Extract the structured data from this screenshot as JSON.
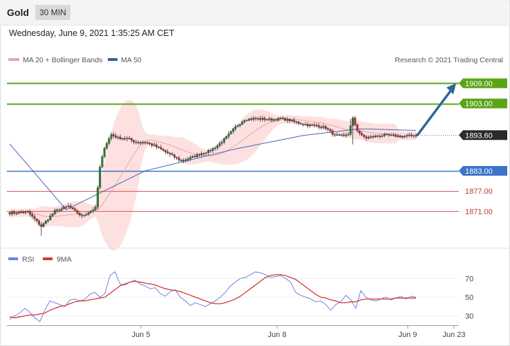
{
  "header": {
    "symbol": "Gold",
    "timeframe": "30 MIN"
  },
  "datetime": "Wednesday, June 9, 2021 1:35:25 AM CET",
  "copyright": "Research © 2021 Trading Central",
  "legend": {
    "bb": "MA 20 + Bollinger Bands",
    "ma50": "MA 50",
    "rsi": "RSI",
    "ma9": "9MA"
  },
  "colors": {
    "resistance": "#5aa517",
    "support": "#3b73c9",
    "target": "#e0585d",
    "current": "#2a2a2a",
    "candle_up": "#2e7d32",
    "candle_down": "#c62828",
    "bb_fill": "#fde0e0",
    "ma20": "#e8a6a6",
    "ma50": "#4a63b8",
    "rsi": "#6b85e0",
    "rsi_ma": "#d43838",
    "arrow": "#2f6699"
  },
  "chart_data": [
    {
      "type": "candlestick",
      "title": "Gold",
      "ylim": [
        1861,
        1914
      ],
      "x_ticks": [
        "Jun 5",
        "Jun 8",
        "Jun 9",
        "Jun 23"
      ],
      "levels": [
        {
          "value": 1909.0,
          "label": "1909.00",
          "kind": "resistance"
        },
        {
          "value": 1903.0,
          "label": "1903.00",
          "kind": "resistance"
        },
        {
          "value": 1893.6,
          "label": "1893.60",
          "kind": "current"
        },
        {
          "value": 1883.0,
          "label": "1883.00",
          "kind": "support"
        },
        {
          "value": 1877.0,
          "label": "1877.00",
          "kind": "target"
        },
        {
          "value": 1871.0,
          "label": "1871.00",
          "kind": "target"
        }
      ],
      "close_anchors": [
        [
          0,
          1870.5
        ],
        [
          8,
          1870.8
        ],
        [
          14,
          1866.5
        ],
        [
          20,
          1871.0
        ],
        [
          26,
          1872.5
        ],
        [
          32,
          1869.5
        ],
        [
          38,
          1872.0
        ],
        [
          40,
          1884.0
        ],
        [
          42,
          1890.0
        ],
        [
          45,
          1893.8
        ],
        [
          48,
          1892.8
        ],
        [
          52,
          1892.6
        ],
        [
          56,
          1891.5
        ],
        [
          60,
          1891.5
        ],
        [
          64,
          1890.5
        ],
        [
          68,
          1889.0
        ],
        [
          72,
          1887.5
        ],
        [
          76,
          1886.0
        ],
        [
          80,
          1886.8
        ],
        [
          84,
          1888.0
        ],
        [
          88,
          1888.8
        ],
        [
          92,
          1890.5
        ],
        [
          96,
          1893.0
        ],
        [
          100,
          1896.0
        ],
        [
          104,
          1898.2
        ],
        [
          108,
          1898.5
        ],
        [
          112,
          1898.4
        ],
        [
          116,
          1898.2
        ],
        [
          120,
          1898.5
        ],
        [
          124,
          1898.0
        ],
        [
          128,
          1897.2
        ],
        [
          132,
          1896.6
        ],
        [
          136,
          1896.4
        ],
        [
          140,
          1895.8
        ],
        [
          144,
          1893.5
        ],
        [
          148,
          1893.4
        ],
        [
          150,
          1894.0
        ],
        [
          152,
          1898.5
        ],
        [
          154,
          1895.0
        ],
        [
          156,
          1893.4
        ],
        [
          158,
          1892.8
        ],
        [
          162,
          1893.3
        ],
        [
          166,
          1893.6
        ],
        [
          170,
          1893.4
        ],
        [
          174,
          1893.2
        ],
        [
          178,
          1893.5
        ],
        [
          180,
          1893.6
        ]
      ],
      "ma50_anchors": [
        [
          0,
          1891
        ],
        [
          25,
          1871.5
        ],
        [
          60,
          1883
        ],
        [
          100,
          1889.5
        ],
        [
          130,
          1893.5
        ],
        [
          155,
          1895.5
        ],
        [
          180,
          1895.0
        ]
      ],
      "forecast": {
        "from": 1893.6,
        "to": 1909.0
      }
    },
    {
      "type": "line",
      "title": "RSI",
      "ylim": [
        20,
        85
      ],
      "y_ticks": [
        70,
        50,
        30
      ],
      "series": [
        {
          "name": "RSI",
          "values": [
            26,
            30,
            33,
            38,
            34,
            28,
            24,
            36,
            46,
            44,
            42,
            40,
            47,
            48,
            46,
            48,
            53,
            55,
            50,
            54,
            73,
            77,
            64,
            63,
            66,
            68,
            64,
            62,
            59,
            60,
            54,
            51,
            56,
            58,
            50,
            46,
            41,
            44,
            42,
            40,
            43,
            46,
            50,
            55,
            62,
            66,
            70,
            71,
            74,
            77,
            76,
            74,
            71,
            72,
            73,
            70,
            66,
            55,
            52,
            50,
            48,
            45,
            46,
            42,
            36,
            42,
            45,
            52,
            47,
            38,
            57,
            50,
            47,
            46,
            48,
            50,
            47,
            49,
            51,
            48,
            51,
            50
          ]
        },
        {
          "name": "9MA",
          "values": [
            29,
            28,
            29,
            30,
            31,
            31,
            32,
            33,
            36,
            38,
            40,
            41,
            43,
            45,
            46,
            46,
            47,
            48,
            49,
            50,
            54,
            58,
            62,
            64,
            66,
            67,
            66,
            65,
            64,
            63,
            61,
            59,
            58,
            57,
            56,
            54,
            52,
            50,
            48,
            46,
            44,
            43,
            43,
            44,
            46,
            48,
            51,
            55,
            59,
            63,
            67,
            71,
            73,
            74,
            74,
            73,
            71,
            69,
            65,
            61,
            57,
            53,
            50,
            49,
            47,
            46,
            44,
            44,
            45,
            45,
            47,
            48,
            48,
            48,
            48,
            48,
            48,
            49,
            49,
            49,
            49,
            49
          ]
        }
      ]
    }
  ]
}
